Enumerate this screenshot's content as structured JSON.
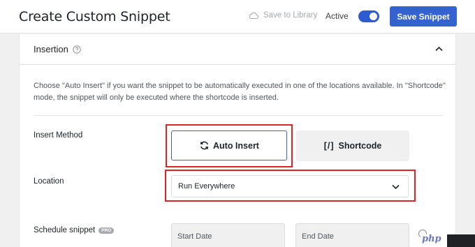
{
  "header": {
    "title": "Create Custom Snippet",
    "save_to_library": "Save to Library",
    "active_label": "Active",
    "active_on": true,
    "save_button": "Save Snippet"
  },
  "insertion": {
    "title": "Insertion",
    "description": "Choose \"Auto Insert\" if you want the snippet to be automatically executed in one of the locations available. In \"Shortcode\" mode, the snippet will only be executed where the shortcode is inserted.",
    "insert_method_label": "Insert Method",
    "auto_insert_label": "Auto Insert",
    "shortcode_bracket": "[/]",
    "shortcode_label": "Shortcode",
    "location_label": "Location",
    "location_value": "Run Everywhere",
    "schedule_label": "Schedule snippet",
    "pro_badge": "PRO",
    "start_date_placeholder": "Start Date",
    "end_date_placeholder": "End Date"
  },
  "watermark": "php",
  "colors": {
    "accent": "#3462cf",
    "highlight": "#dd2323"
  }
}
